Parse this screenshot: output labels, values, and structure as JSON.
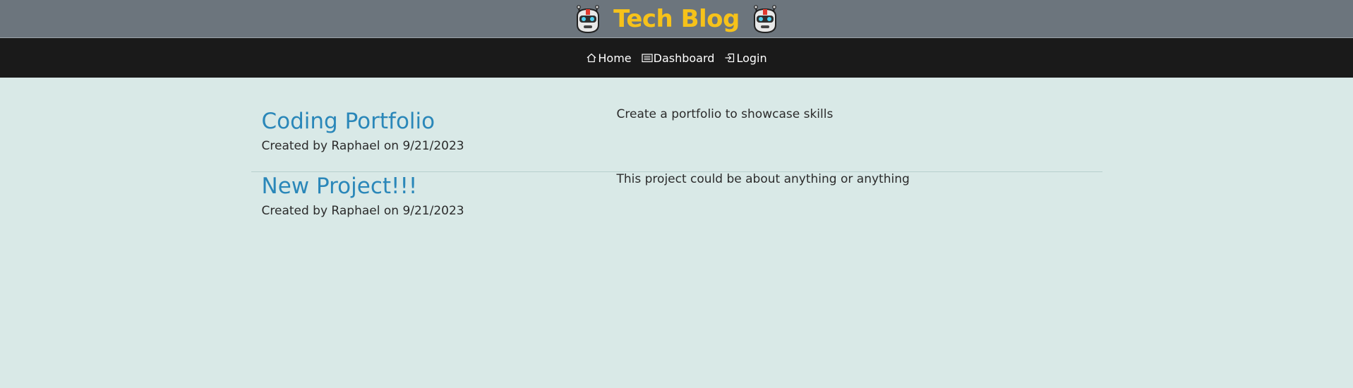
{
  "header": {
    "title": "Tech Blog",
    "left_icon": "robot-icon",
    "right_icon": "robot-icon",
    "title_color": "#f6c21a",
    "background": "#6c757d"
  },
  "nav": {
    "background": "#1a1a1a",
    "items": [
      {
        "label": "Home",
        "icon": "home-icon"
      },
      {
        "label": "Dashboard",
        "icon": "list-icon"
      },
      {
        "label": "Login",
        "icon": "login-icon"
      }
    ]
  },
  "posts": [
    {
      "title": "Coding Portfolio",
      "meta": "Created by Raphael on 9/21/2023",
      "description": "Create a portfolio to showcase skills"
    },
    {
      "title": "New Project!!!",
      "meta": "Created by Raphael on 9/21/2023",
      "description": "This project could be about anything or anything"
    }
  ],
  "colors": {
    "page_background": "#d9e9e7",
    "post_title": "#2a87b9"
  }
}
